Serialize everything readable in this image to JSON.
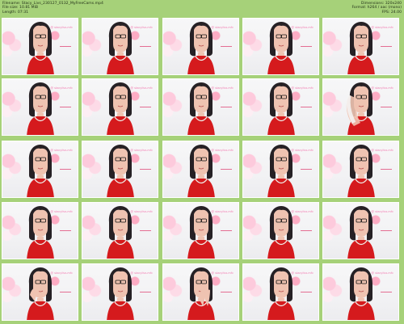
{
  "header": {
    "filename": "Filename: Stacy_Livs_230127_0132_MyFreeCams.mp4",
    "file_size": "File size: 10.81 MiB",
    "length": "Length: 07:31",
    "dimensions": "Dimensions: 320x240",
    "format": "Format: h264 / aac (mono)",
    "fps": "FPS: 24.00"
  },
  "colors": {
    "sheet_background": "#a6d179",
    "dress": "#d51a1d",
    "hair": "#262125",
    "skin": "#efc3b1",
    "watermark": "#f27ab0"
  },
  "thumbnails": [
    {
      "watermark": "@ stacylivs.mfc"
    },
    {
      "watermark": "@ stacylivs.mfc"
    },
    {
      "watermark": "@ stacylivs.mfc"
    },
    {
      "watermark": "@ stacylivs.mfc"
    },
    {
      "watermark": "@ stacylivs.mfc"
    },
    {
      "watermark": "@ stacylivs.mfc"
    },
    {
      "watermark": "@ stacylivs.mfc"
    },
    {
      "watermark": "@ stacylivs.mfc"
    },
    {
      "watermark": "@ stacylivs.mfc"
    },
    {
      "watermark": "@ stacylivs.mfc"
    },
    {
      "watermark": "@ stacylivs.mfc"
    },
    {
      "watermark": "@ stacylivs.mfc"
    },
    {
      "watermark": "@ stacylivs.mfc"
    },
    {
      "watermark": "@ stacylivs.mfc"
    },
    {
      "watermark": "@ stacylivs.mfc"
    },
    {
      "watermark": "@ stacylivs.mfc"
    },
    {
      "watermark": "@ stacylivs.mfc"
    },
    {
      "watermark": "@ stacylivs.mfc"
    },
    {
      "watermark": "@ stacylivs.mfc"
    },
    {
      "watermark": "@ stacylivs.mfc"
    },
    {
      "watermark": "@ stacylivs.mfc"
    },
    {
      "watermark": "@ stacylivs.mfc"
    },
    {
      "watermark": "@ stacylivs.mfc"
    },
    {
      "watermark": "@ stacylivs.mfc"
    },
    {
      "watermark": "@ stacylivs.mfc"
    }
  ]
}
